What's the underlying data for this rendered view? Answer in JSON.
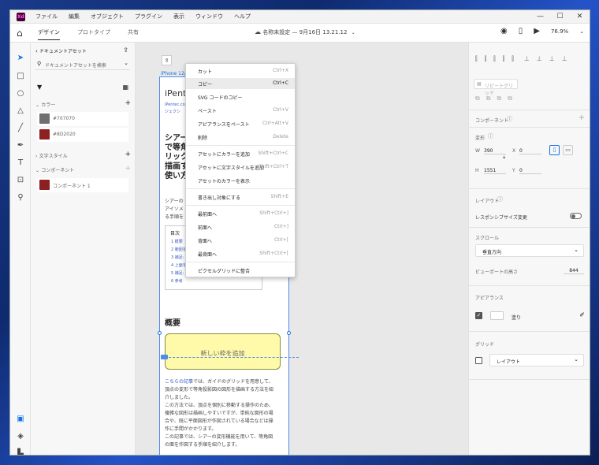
{
  "app": {
    "logo": "Xd",
    "menu": [
      "ファイル",
      "編集",
      "オブジェクト",
      "プラグイン",
      "表示",
      "ウィンドウ",
      "ヘルプ"
    ],
    "window_controls": [
      "—",
      "☐",
      "✕"
    ]
  },
  "toolbar": {
    "tabs": [
      "デザイン",
      "プロトタイプ",
      "共有"
    ],
    "doc_title": "名称未設定 — 9月16日 13.21.12",
    "zoom": "76.9%"
  },
  "assets": {
    "breadcrumb": "ドキュメントアセット",
    "search_placeholder": "ドキュメントアセットを検索",
    "colors_title": "カラー",
    "colors": [
      {
        "hex": "#707070",
        "label": "#707070"
      },
      {
        "hex": "#8D2020",
        "label": "#8D2020"
      }
    ],
    "charstyles_title": "文字スタイル",
    "components_title": "コンポーネント",
    "component_item": "コンポーネント 1",
    "component_color": "#8D2020"
  },
  "canvas": {
    "artboard_label": "iPhone 12/13 Pro – 1",
    "brand_title": "iPent",
    "brand_sub1": "iPentec.co",
    "brand_sub2": "ジェクシ",
    "heading_lines": [
      "シアー",
      "で等角",
      "リック",
      "描画す",
      "使い方"
    ],
    "para_lines": [
      "シアーの",
      "アイソメ",
      "る手順を"
    ],
    "toc_title": "目次",
    "toc_items": [
      "1 概要",
      "2 範囲を",
      "3 補足:",
      "4 上面を",
      "5 補足:",
      "6 参考"
    ],
    "section_title": "概要",
    "sticky_text": "新しい枠を追加",
    "link_text": "こちらの記事",
    "body_lines": [
      "では、ガイドのグリッドを用意して、",
      "頂点の変形で等角投影図の図形を描画する方法を紹",
      "介しました。",
      "この方法では、頂点を個別に移動する操作のため、",
      "複雑な図形は描画しやすいですが、単純な図形の場",
      "合や、既に平面図形が作図されている場合などは操",
      "作に手間がかかります。",
      "この記事では、シアーの変形機能を用いて、等角図",
      "の面を作図する手順を紹介します。"
    ]
  },
  "context_menu": [
    {
      "label": "カット",
      "key": "Ctrl+X"
    },
    {
      "label": "コピー",
      "key": "Ctrl+C",
      "highlight": true
    },
    {
      "label": "SVG コードのコピー",
      "key": ""
    },
    {
      "label": "ペースト",
      "key": "Ctrl+V"
    },
    {
      "label": "アピアランスをペースト",
      "key": "Ctrl+Alt+V"
    },
    {
      "label": "削除",
      "key": "Delete"
    },
    {
      "label": "アセットにカラーを追加",
      "key": "Shift+Ctrl+C"
    },
    {
      "label": "アセットに文字スタイルを追加",
      "key": "Shift+Ctrl+T"
    },
    {
      "label": "アセットのカラーを表示",
      "key": ""
    },
    {
      "label": "書き出し対象にする",
      "key": "Shift+E"
    },
    {
      "label": "最前面へ",
      "key": "Shift+Ctrl+]"
    },
    {
      "label": "前面へ",
      "key": "Ctrl+]"
    },
    {
      "label": "背面へ",
      "key": "Ctrl+["
    },
    {
      "label": "最背面へ",
      "key": "Shift+Ctrl+["
    },
    {
      "label": "ピクセルグリッドに整合",
      "key": ""
    }
  ],
  "right_panel": {
    "repeat_grid": "リピートグリッド",
    "component": "コンポーネント",
    "transform": "変形",
    "w_label": "W",
    "w_value": "390",
    "x_label": "X",
    "x_value": "0",
    "h_label": "H",
    "h_value": "1551",
    "y_label": "Y",
    "y_value": "0",
    "layout": "レイアウト",
    "responsive": "レスポンシブサイズ変更",
    "scroll": "スクロール",
    "scroll_value": "垂直方向",
    "viewport_label": "ビューポートの高さ",
    "viewport_value": "844",
    "appearance": "アピアランス",
    "fill": "塗り",
    "grid": "グリッド",
    "grid_value": "レイアウト"
  }
}
